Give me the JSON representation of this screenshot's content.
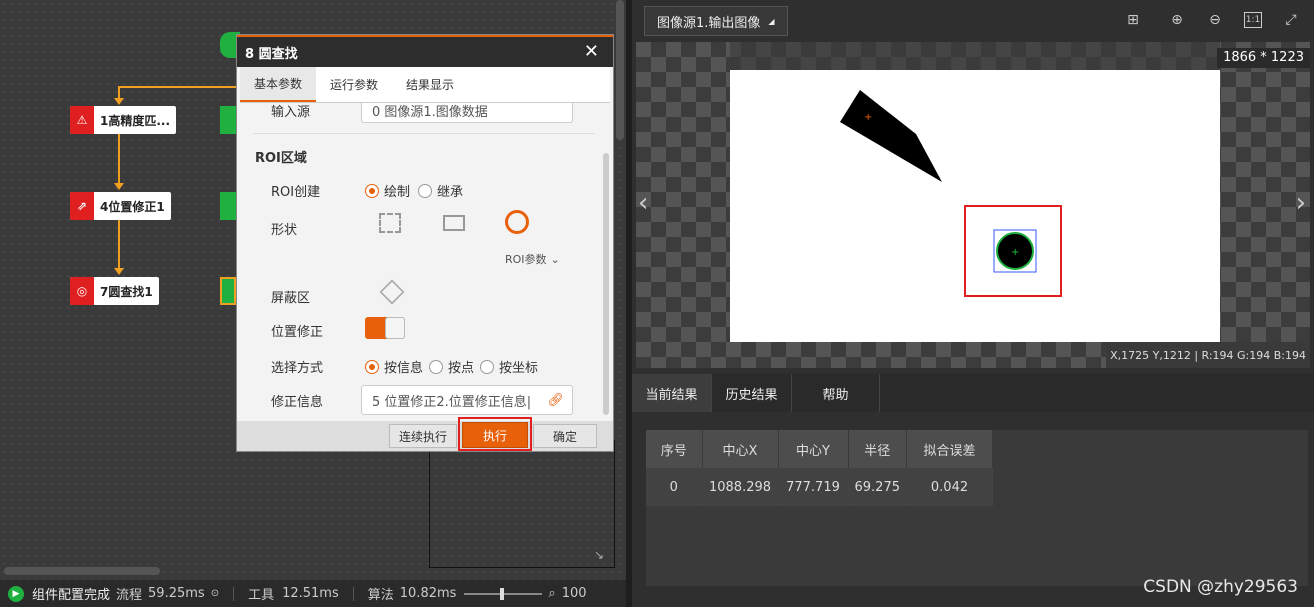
{
  "flow": {
    "nodes": [
      {
        "label": "1高精度匹...",
        "color": "#e02020"
      },
      {
        "label": "4位置修正1",
        "color": "#e02020"
      },
      {
        "label": "7圆查找1",
        "color": "#e02020"
      }
    ]
  },
  "dialog": {
    "title": "8 圆查找",
    "close": "✕",
    "tabs": [
      "基本参数",
      "运行参数",
      "结果显示"
    ],
    "input_source_label": "输入源",
    "input_source_value": "0 图像源1.图像数据",
    "roi_section": "ROI区域",
    "roi_create_label": "ROI创建",
    "roi_opt_draw": "绘制",
    "roi_opt_inherit": "继承",
    "shape_label": "形状",
    "roi_params": "ROI参数",
    "mask_label": "屏蔽区",
    "pos_correct_label": "位置修正",
    "select_mode_label": "选择方式",
    "mode_by_info": "按信息",
    "mode_by_point": "按点",
    "mode_by_coord": "按坐标",
    "correct_info_label": "修正信息",
    "correct_info_value": "5 位置修正2.位置修正信息|",
    "btn_continuous": "连续执行",
    "btn_execute": "执行",
    "btn_ok": "确定"
  },
  "viewer": {
    "tab_label": "图像源1.输出图像",
    "image_size": "1866 * 1223",
    "pixel_info": "X,1725  Y,1212  |  R:194  G:194  B:194"
  },
  "results": {
    "tabs": [
      "当前结果",
      "历史结果",
      "帮助"
    ],
    "columns": [
      "序号",
      "中心X",
      "中心Y",
      "半径",
      "拟合误差"
    ],
    "rows": [
      [
        "0",
        "1088.298",
        "777.719",
        "69.275",
        "0.042"
      ]
    ]
  },
  "status": {
    "message": "组件配置完成",
    "flow_label": "流程",
    "flow_time": "59.25ms",
    "tool_label": "工具",
    "tool_time": "12.51ms",
    "algo_label": "算法",
    "algo_time": "10.82ms",
    "zoom": "100"
  },
  "watermark": "CSDN @zhy29563"
}
